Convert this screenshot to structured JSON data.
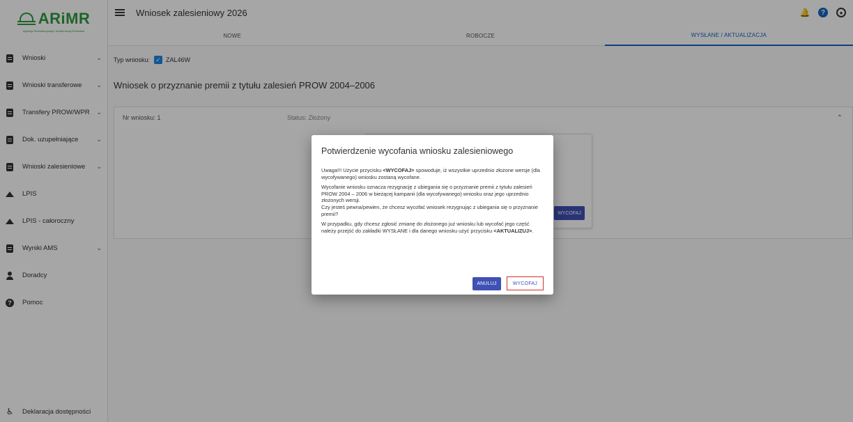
{
  "logo": {
    "text": "ARiMR",
    "subtitle": "Agencja Restrukturyzacji i Modernizacji Rolnictwa"
  },
  "sidebar": {
    "items": [
      {
        "label": "Wnioski",
        "icon": "document-icon",
        "chevron": true
      },
      {
        "label": "Wnioski transferowe",
        "icon": "document-icon",
        "chevron": true
      },
      {
        "label": "Transfery PROW/WPR",
        "icon": "document-icon",
        "chevron": true
      },
      {
        "label": "Dok. uzupełniające",
        "icon": "document-icon",
        "chevron": true
      },
      {
        "label": "Wnioski zalesieniowe",
        "icon": "document-icon",
        "chevron": true
      },
      {
        "label": "LPIS",
        "icon": "terrain-icon",
        "chevron": false
      },
      {
        "label": "LPIS - całoroczny",
        "icon": "terrain-icon",
        "chevron": false
      },
      {
        "label": "Wyniki AMS",
        "icon": "document-icon",
        "chevron": true
      },
      {
        "label": "Doradcy",
        "icon": "person-icon",
        "chevron": false
      },
      {
        "label": "Pomoc",
        "icon": "help-icon",
        "chevron": false
      }
    ],
    "bottom_label": "Deklaracja dostępności"
  },
  "header": {
    "title": "Wniosek zalesieniowy 2026",
    "tabs": [
      {
        "label": "NOWE",
        "active": false
      },
      {
        "label": "ROBOCZE",
        "active": false
      },
      {
        "label": "WYSŁANE / AKTUALIZACJA",
        "active": true
      }
    ],
    "icons": [
      "bell-icon",
      "help-icon",
      "user-icon"
    ]
  },
  "main": {
    "type_label": "Typ wniosku:",
    "type_value": "ZAL46W",
    "app_title": "Wniosek o przyznanie premii z tytułu zalesień PROW 2004–2006",
    "card": {
      "nr_label": "Nr wniosku: 1",
      "status_label": "Status: Złożony",
      "inner_button": "WYCOFAJ"
    }
  },
  "dialog": {
    "title": "Potwierdzenie wycofania wniosku zalesieniowego",
    "p1_a": "Uwaga!!! Użycie przycisku ",
    "p1_b": "<WYCOFAJ>",
    "p1_c": " spowoduje, iż wszystkie uprzednio złożone wersje (dla wycofywanego) wniosku zostaną wycofane.",
    "p2": "Wycofanie wniosku oznacza rezygnację z ubiegania się o przyznanie premii z tytułu zalesień PROW 2004 – 2006 w bieżącej kampanii (dla wycofywanego) wniosku oraz jego uprzednio złożonych wersji.",
    "p3": "Czy jesteś pewna/pewien, że chcesz wycofać wniosek rezygnując z ubiegania się o przyznanie premii?",
    "p4_a": "W przypadku, gdy chcesz zgłosić zmianę do złożonego już wniosku lub wycofać jego część należy przejść do zakładki WYSŁANE i dla danego wniosku użyć przycisku ",
    "p4_b": "<AKTUALIZUJ>",
    "p4_c": ".",
    "cancel_label": "ANULUJ",
    "confirm_label": "WYCOFAJ"
  },
  "colors": {
    "brand_green": "#2d9a3c",
    "primary_blue": "#3f51b5",
    "tab_active": "#1565c0",
    "highlight_red": "#d32f2f"
  }
}
